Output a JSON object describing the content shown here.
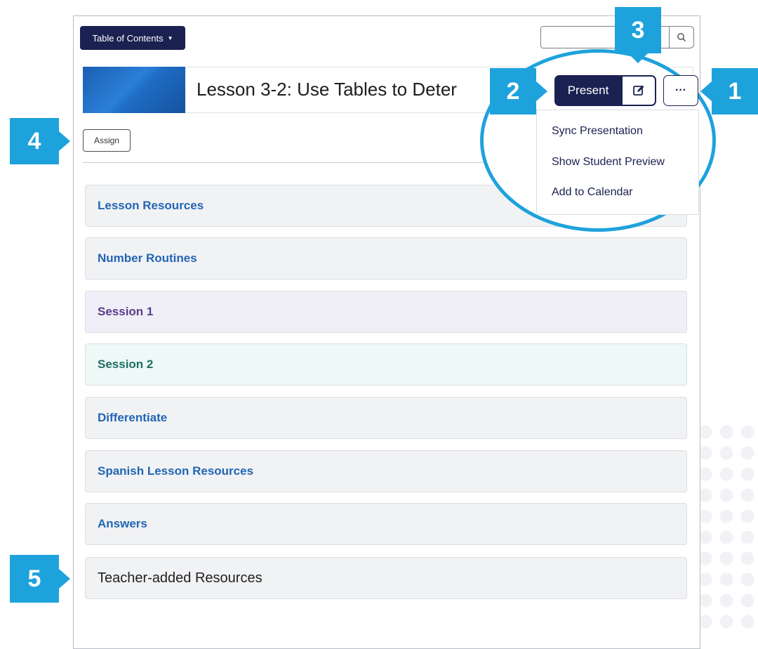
{
  "toolbar": {
    "toc_label": "Table of Contents",
    "search_placeholder": ""
  },
  "lesson": {
    "title": "Lesson 3-2: Use Tables to Deter",
    "assign_label": "Assign",
    "present_label": "Present",
    "more_label": "···"
  },
  "menu": {
    "items": [
      "Sync Presentation",
      "Show Student Preview",
      "Add to Calendar"
    ]
  },
  "sections": [
    {
      "label": "Lesson Resources"
    },
    {
      "label": "Number Routines"
    },
    {
      "label": "Session 1"
    },
    {
      "label": "Session 2"
    },
    {
      "label": "Differentiate"
    },
    {
      "label": "Spanish Lesson Resources"
    },
    {
      "label": "Answers"
    },
    {
      "label": "Teacher-added Resources"
    }
  ],
  "callouts": [
    "1",
    "2",
    "3",
    "4",
    "5"
  ],
  "colors": {
    "navy": "#1b2151",
    "accent": "#1ea2dc",
    "link": "#2266b5",
    "purple": "#5b3c8a",
    "teal": "#1e6e63"
  }
}
